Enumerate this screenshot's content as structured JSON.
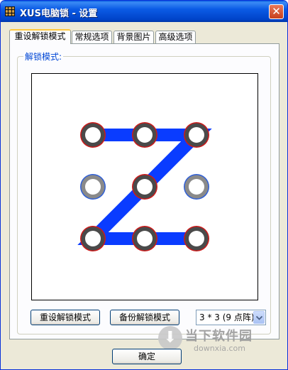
{
  "window": {
    "title": "XUS电脑锁 - 设置",
    "close_glyph": "✕",
    "app_icon": "grid-app-icon"
  },
  "tabs": [
    {
      "label": "重设解锁模式",
      "active": true
    },
    {
      "label": "常规选项",
      "active": false
    },
    {
      "label": "背景图片",
      "active": false
    },
    {
      "label": "高级选项",
      "active": false
    }
  ],
  "panel": {
    "group_label": "解锁模式:",
    "pattern": {
      "grid_size": 3,
      "path": [
        0,
        1,
        2,
        4,
        6,
        7,
        8
      ],
      "colors": {
        "line": "#0a3cff",
        "node_ring_selected": "#cc1a1a",
        "node_ring_unselected": "#2f5fd6",
        "node_outer_selected": "#4a4a4a",
        "node_outer_unselected": "#8a8a8a"
      }
    },
    "buttons": {
      "reset_label": "重设解锁模式",
      "backup_label": "备份解锁模式"
    },
    "grid_select": {
      "value": "3 * 3 (9 点阵)"
    }
  },
  "footer": {
    "ok_label": "确定"
  },
  "watermark": {
    "title": "当下软件园",
    "url": "downxia.com",
    "icon": "download-arrow-icon"
  },
  "theme": {
    "titlebar": "#0054e3",
    "window_bg": "#ece9d8",
    "group_label_color": "#0046d5"
  }
}
